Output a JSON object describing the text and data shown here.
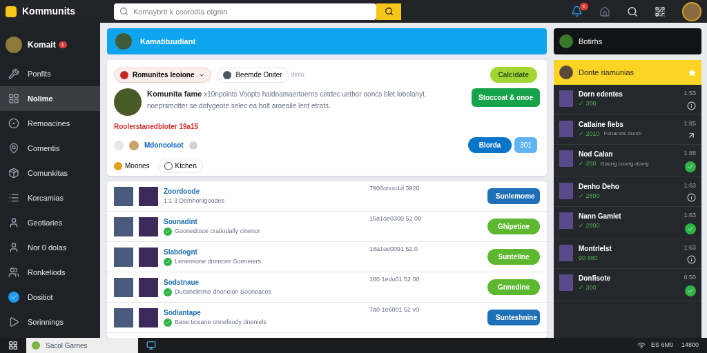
{
  "topbar": {
    "brand": "Kommunits",
    "search": {
      "placeholder": "Komaybrit k coorodia otgnin"
    },
    "notification_badge": "e"
  },
  "sidebar": {
    "profile": {
      "name": "Komait",
      "badge": "1"
    },
    "items": [
      {
        "label": "Ponfits",
        "selected": false
      },
      {
        "label": "Nolime",
        "selected": true
      },
      {
        "label": "Remoacines",
        "selected": false
      },
      {
        "label": "Comentis",
        "selected": false
      },
      {
        "label": "Comunkitas",
        "selected": false
      },
      {
        "label": "Korcamias",
        "selected": false
      },
      {
        "label": "Geotiaries",
        "selected": false
      },
      {
        "label": "Nor 0 dolas",
        "selected": false
      },
      {
        "label": "Ronkeliods",
        "selected": false
      },
      {
        "label": "Dositiot",
        "selected": false
      },
      {
        "label": "Sorinnings",
        "selected": false
      }
    ]
  },
  "banner": {
    "title": "Kamatituudiant"
  },
  "post": {
    "chips": [
      {
        "label": "Romunites leoione",
        "kind": "dropdown"
      },
      {
        "label": "Beemde Oniter",
        "kind": "plain"
      }
    ],
    "chip_note": "disto",
    "author": "Komunita fame",
    "text": "x10npoints Voopts haldnamaertoerns cetdec uethor ooncs blet lobolanyt. noeprsmotter se dofygeote selec ea bolt aroeaile lent etrats.",
    "tag": "Calcidate",
    "action": "Stoccoat & onoe",
    "alert": "Roolerstanedbloter 19a15",
    "user": "Mdonoolsot",
    "primary": "Blorda",
    "count": "301",
    "footer": [
      {
        "label": "Moones",
        "kind": "coin"
      },
      {
        "label": "Ktchen",
        "kind": "outline"
      }
    ]
  },
  "list": [
    {
      "title": "Zoordoode",
      "subtitle": "1:1 3 Demhonigoodes",
      "time": "7900onoo1d 3926",
      "button": "Sunlemome",
      "kind": "blue",
      "verified": false
    },
    {
      "title": "Sounadint",
      "subtitle": "Goonedoste cratiodally cinenor",
      "time": "15a1oe0300 52 00",
      "button": "Ghipetine",
      "kind": "green",
      "verified": true
    },
    {
      "title": "Slabdognt",
      "subtitle": "Lenereione dnencier Soeneiers",
      "time": "18a1oe0091 52.0",
      "button": "Sunteline",
      "kind": "green",
      "verified": true
    },
    {
      "title": "Sodstnaue",
      "subtitle": "Ducanelmme dnoneion Sooneaces",
      "time": "180 1edo01 52 00",
      "button": "Gnnedine",
      "kind": "green",
      "verified": true
    },
    {
      "title": "Sodiantape",
      "subtitle": "Bane ticeane onnefeody dneniels",
      "time": "7a0 1e6001 52 v0",
      "button": "Sunteshnine",
      "kind": "blue",
      "verified": true
    }
  ],
  "right": {
    "title": "Botirhs",
    "board_title": "Donte riamunias",
    "entries": [
      {
        "name": "Dorn edentes",
        "score": "✓ 300",
        "time": "1:53",
        "kind": "info"
      },
      {
        "name": "Catlaine fiebs",
        "score": "✓ 2010",
        "time": "1:85",
        "sub": "Fonancis dorsb",
        "kind": "arrow"
      },
      {
        "name": "Nod Calan",
        "score": "✓ 280",
        "time": "1:88",
        "sub": "Gaung conrig-domy",
        "kind": "check"
      },
      {
        "name": "Denho Deho",
        "score": "✓ 2890",
        "time": "1:63",
        "kind": "info"
      },
      {
        "name": "Nann Gamlet",
        "score": "✓ 2890",
        "time": "1:63",
        "kind": "check"
      },
      {
        "name": "Montrlelst",
        "score": "90 880",
        "time": "1:63",
        "kind": "info"
      },
      {
        "name": "Donfisote",
        "score": "✓ 300",
        "time": "6:50",
        "kind": "check"
      }
    ]
  },
  "taskbar": {
    "app": "Sacol Garnes",
    "tray": [
      "ES 6M0",
      "14800"
    ]
  }
}
